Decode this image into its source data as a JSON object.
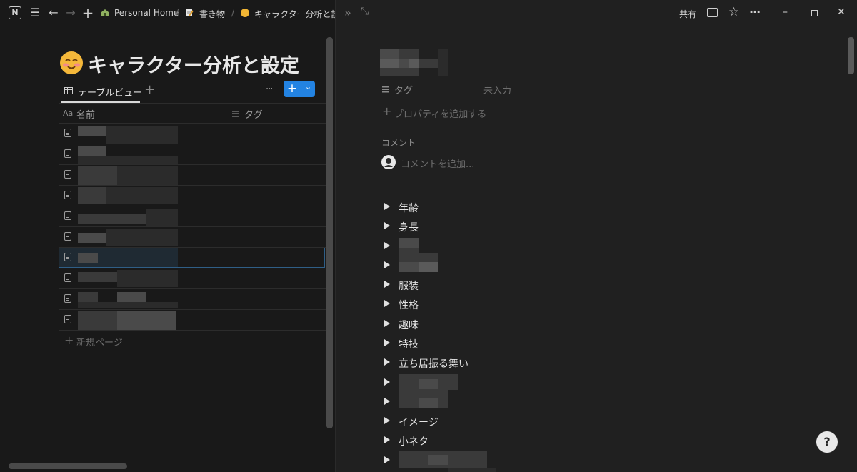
{
  "breadcrumb": {
    "workspace": "Personal Home",
    "parent": "書き物",
    "current": "キャラクター分析と設"
  },
  "header": {
    "share_label": "共有"
  },
  "page": {
    "emoji": "😊",
    "title": "キャラクター分析と設定"
  },
  "view": {
    "tab_label": "テーブルビュー",
    "add_view": "+",
    "more": "···",
    "new_button": "+",
    "new_dropdown": "⌄"
  },
  "table": {
    "col_name_prefix": "Aa",
    "col_name": "名前",
    "col_tag": "タグ",
    "new_page": "新規ページ"
  },
  "detail": {
    "property_tag_label": "タグ",
    "property_tag_value": "未入力",
    "add_property": "プロパティを追加する",
    "comments_label": "コメント",
    "comment_placeholder": "コメントを追加..."
  },
  "toggles": [
    "年齢",
    "身長",
    "",
    "",
    "服装",
    "性格",
    "趣味",
    "特技",
    "立ち居振る舞い",
    "",
    "",
    "イメージ",
    "小ネタ",
    ""
  ],
  "help_icon": "?"
}
